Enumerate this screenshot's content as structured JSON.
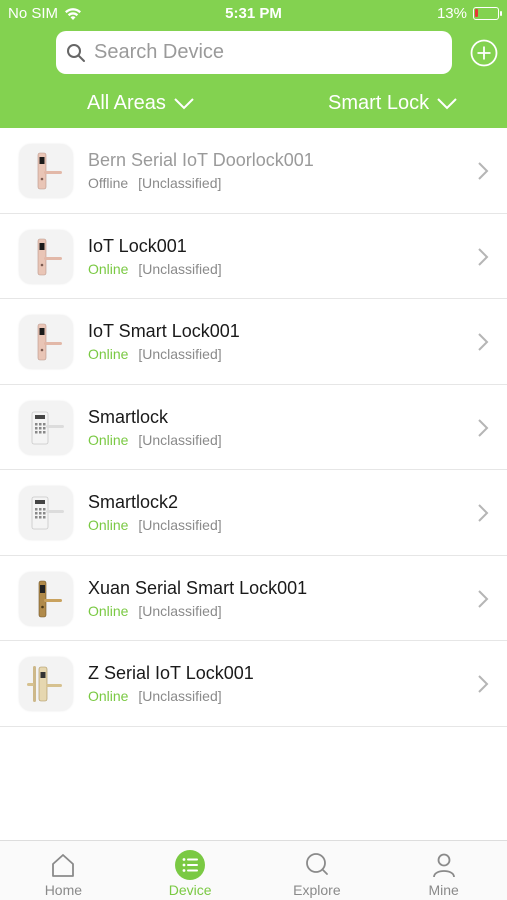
{
  "status_bar": {
    "carrier": "No SIM",
    "time": "5:31 PM",
    "battery_percent": "13%",
    "battery_level": 0.13
  },
  "header": {
    "search_placeholder": "Search Device",
    "area_filter": "All Areas",
    "type_filter": "Smart Lock",
    "accent_color": "#83d250"
  },
  "devices": [
    {
      "name": "Bern Serial IoT Doorlock001",
      "status": "Offline",
      "category": "[Unclassified]",
      "icon": "lever-lock-icon"
    },
    {
      "name": "IoT Lock001",
      "status": "Online",
      "category": "[Unclassified]",
      "icon": "lever-lock-icon"
    },
    {
      "name": "IoT Smart Lock001",
      "status": "Online",
      "category": "[Unclassified]",
      "icon": "lever-lock-icon"
    },
    {
      "name": "Smartlock",
      "status": "Online",
      "category": "[Unclassified]",
      "icon": "keypad-lock-icon"
    },
    {
      "name": "Smartlock2",
      "status": "Online",
      "category": "[Unclassified]",
      "icon": "keypad-lock-icon"
    },
    {
      "name": "Xuan Serial Smart Lock001",
      "status": "Online",
      "category": "[Unclassified]",
      "icon": "gold-lever-lock-icon"
    },
    {
      "name": "Z Serial IoT Lock001",
      "status": "Online",
      "category": "[Unclassified]",
      "icon": "gold-handle-lock-icon"
    }
  ],
  "tabs": [
    {
      "label": "Home",
      "icon": "home-icon",
      "active": false
    },
    {
      "label": "Device",
      "icon": "list-icon",
      "active": true
    },
    {
      "label": "Explore",
      "icon": "search-icon",
      "active": false
    },
    {
      "label": "Mine",
      "icon": "person-icon",
      "active": false
    }
  ]
}
